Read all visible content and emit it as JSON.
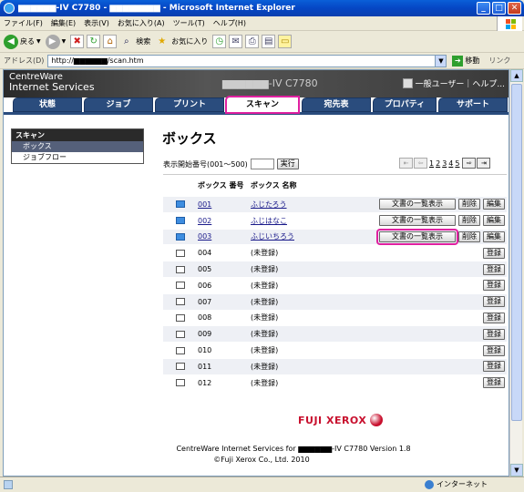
{
  "window": {
    "title": "▆▆▆▆▆▆-IV C7780 - ▆▆▆▆▆▆▆▆ - Microsoft Internet Explorer",
    "min": "_",
    "max": "□",
    "close": "✕"
  },
  "menu": [
    "ファイル(F)",
    "編集(E)",
    "表示(V)",
    "お気に入り(A)",
    "ツール(T)",
    "ヘルプ(H)"
  ],
  "toolbar": {
    "back": "戻る",
    "search": "検索",
    "favorites": "お気に入り"
  },
  "address": {
    "label": "アドレス(D)",
    "url": "http://▆▆▆▆▆▆/scan.htm",
    "go": "移動",
    "links": "リンク"
  },
  "header": {
    "brand_line1": "CentreWare",
    "brand_line2": "Internet Services",
    "model": "▆▆▆▆▆▆-IV C7780",
    "user": "一般ユーザー｜ヘルプ..."
  },
  "tabs": [
    "状態",
    "ジョブ",
    "プリント",
    "スキャン",
    "宛先表",
    "プロパティ",
    "サポート"
  ],
  "active_tab": "スキャン",
  "leftnav": {
    "heading": "スキャン",
    "items": [
      "ボックス",
      "ジョブフロー"
    ],
    "selected": "ボックス"
  },
  "main": {
    "title": "ボックス",
    "start_label": "表示開始番号(001〜500)",
    "start_value": "",
    "run_button": "実行",
    "pages": [
      "1",
      "2",
      "3",
      "4",
      "5"
    ],
    "col_number": "ボックス 番号",
    "col_name": "ボックス 名称"
  },
  "boxes": [
    {
      "number": "001",
      "name": "ふじたろう",
      "registered": true
    },
    {
      "number": "002",
      "name": "ふじはなこ",
      "registered": true
    },
    {
      "number": "003",
      "name": "ふじいちろう",
      "registered": true
    },
    {
      "number": "004",
      "name": "(未登録)",
      "registered": false
    },
    {
      "number": "005",
      "name": "(未登録)",
      "registered": false
    },
    {
      "number": "006",
      "name": "(未登録)",
      "registered": false
    },
    {
      "number": "007",
      "name": "(未登録)",
      "registered": false
    },
    {
      "number": "008",
      "name": "(未登録)",
      "registered": false
    },
    {
      "number": "009",
      "name": "(未登録)",
      "registered": false
    },
    {
      "number": "010",
      "name": "(未登録)",
      "registered": false
    },
    {
      "number": "011",
      "name": "(未登録)",
      "registered": false
    },
    {
      "number": "012",
      "name": "(未登録)",
      "registered": false
    }
  ],
  "buttons": {
    "list_docs": "文書の一覧表示",
    "delete": "削除",
    "edit": "編集",
    "register": "登録"
  },
  "footer": {
    "logo": "FUJI XEROX",
    "line1": "CentreWare Internet Services for ▆▆▆▆▆▆-IV C7780 Version 1.8",
    "line2": "©Fuji Xerox Co., Ltd. 2010"
  },
  "status": {
    "zone": "インターネット"
  },
  "colors": {
    "highlight": "#e020a0",
    "tab_blue": "#2a4c7d",
    "brand_red": "#c8102e"
  }
}
